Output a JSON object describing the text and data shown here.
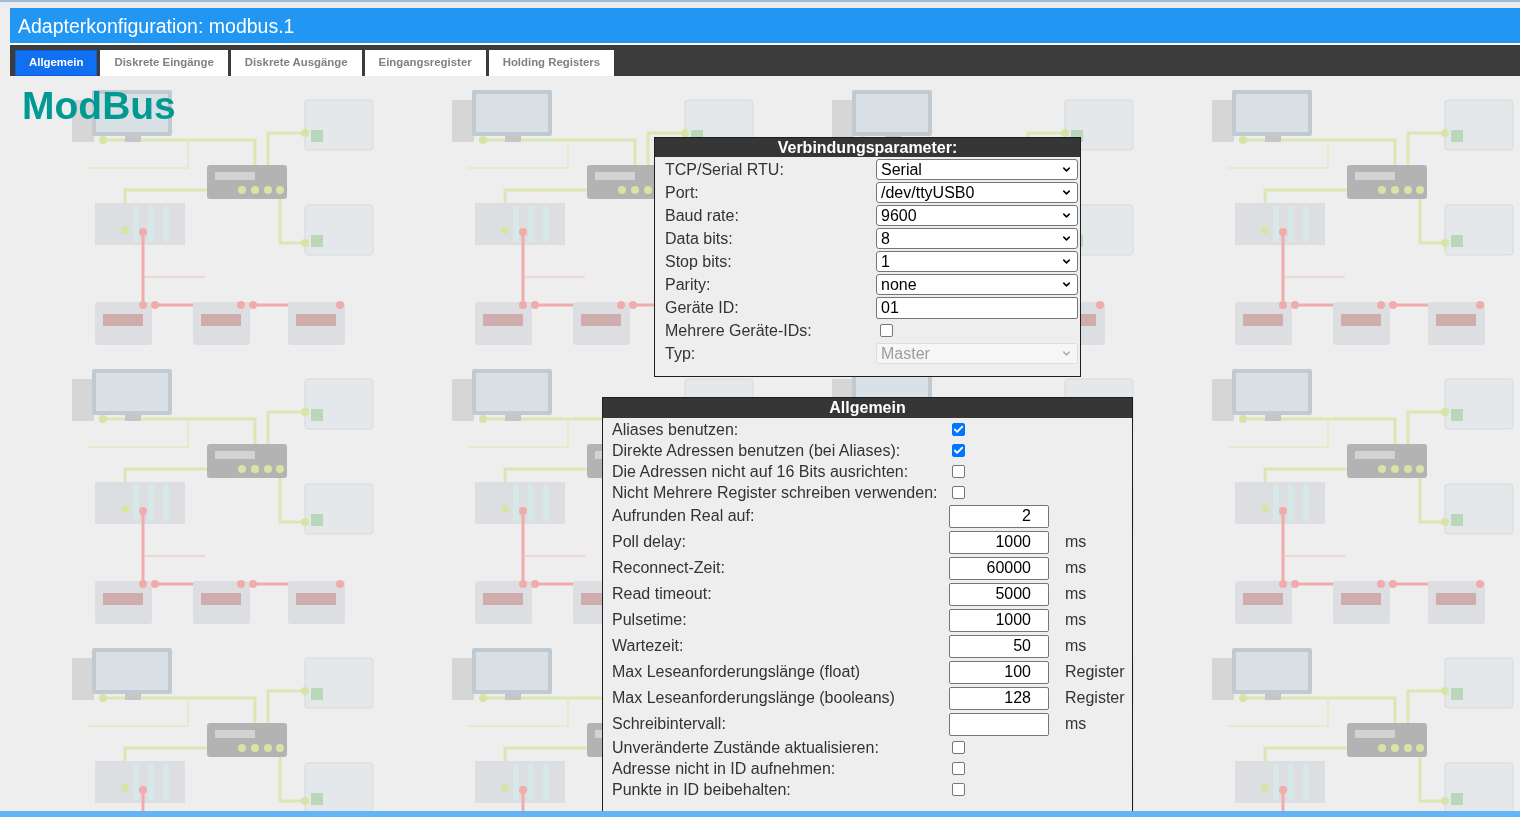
{
  "window": {
    "title": "Adapterkonfiguration: modbus.1"
  },
  "tabs": [
    {
      "label": "Allgemein",
      "selected": true
    },
    {
      "label": "Diskrete Eingänge",
      "selected": false
    },
    {
      "label": "Diskrete Ausgänge",
      "selected": false
    },
    {
      "label": "Eingangsregister",
      "selected": false
    },
    {
      "label": "Holding Registers",
      "selected": false
    }
  ],
  "logo": {
    "text": "ModBus"
  },
  "connection_panel": {
    "title": "Verbindungsparameter:",
    "fields": [
      {
        "kind": "select",
        "label": "TCP/Serial RTU:",
        "value": "Serial",
        "disabled": false
      },
      {
        "kind": "select",
        "label": "Port:",
        "value": "/dev/ttyUSB0",
        "disabled": false
      },
      {
        "kind": "select",
        "label": "Baud rate:",
        "value": "9600",
        "disabled": false
      },
      {
        "kind": "select",
        "label": "Data bits:",
        "value": "8",
        "disabled": false
      },
      {
        "kind": "select",
        "label": "Stop bits:",
        "value": "1",
        "disabled": false
      },
      {
        "kind": "select",
        "label": "Parity:",
        "value": "none",
        "disabled": false
      },
      {
        "kind": "text",
        "label": "Geräte ID:",
        "value": "01"
      },
      {
        "kind": "checkbox",
        "label": "Mehrere Geräte-IDs:",
        "checked": false
      },
      {
        "kind": "select",
        "label": "Typ:",
        "value": "Master",
        "disabled": true
      }
    ]
  },
  "general_panel": {
    "title": "Allgemein",
    "fields": [
      {
        "kind": "checkbox",
        "label": "Aliases benutzen:",
        "checked": true
      },
      {
        "kind": "checkbox",
        "label": "Direkte Adressen benutzen (bei Aliases):",
        "checked": true
      },
      {
        "kind": "checkbox",
        "label": "Die Adressen nicht auf 16 Bits ausrichten:",
        "checked": false
      },
      {
        "kind": "checkbox",
        "label": "Nicht Mehrere Register schreiben verwenden:",
        "checked": false
      },
      {
        "kind": "number",
        "label": "Aufrunden Real auf:",
        "value": "2"
      },
      {
        "kind": "number",
        "label": "Poll delay:",
        "value": "1000",
        "unit": "ms"
      },
      {
        "kind": "number",
        "label": "Reconnect-Zeit:",
        "value": "60000",
        "unit": "ms"
      },
      {
        "kind": "number",
        "label": "Read timeout:",
        "value": "5000",
        "unit": "ms"
      },
      {
        "kind": "number",
        "label": "Pulsetime:",
        "value": "1000",
        "unit": "ms"
      },
      {
        "kind": "number",
        "label": "Wartezeit:",
        "value": "50",
        "unit": "ms"
      },
      {
        "kind": "number",
        "label": "Max Leseanforderungslänge (float)",
        "value": "100",
        "unit": "Register"
      },
      {
        "kind": "number",
        "label": "Max Leseanforderungslänge (booleans)",
        "value": "128",
        "unit": "Register"
      },
      {
        "kind": "number",
        "label": "Schreibintervall:",
        "unit": "ms"
      },
      {
        "kind": "checkbox",
        "label": "Unveränderte Zustände aktualisieren:",
        "checked": false
      },
      {
        "kind": "checkbox",
        "label": "Adresse nicht in ID aufnehmen:",
        "checked": false
      },
      {
        "kind": "checkbox",
        "label": "Punkte in ID beibehalten:",
        "checked": false
      }
    ]
  }
}
